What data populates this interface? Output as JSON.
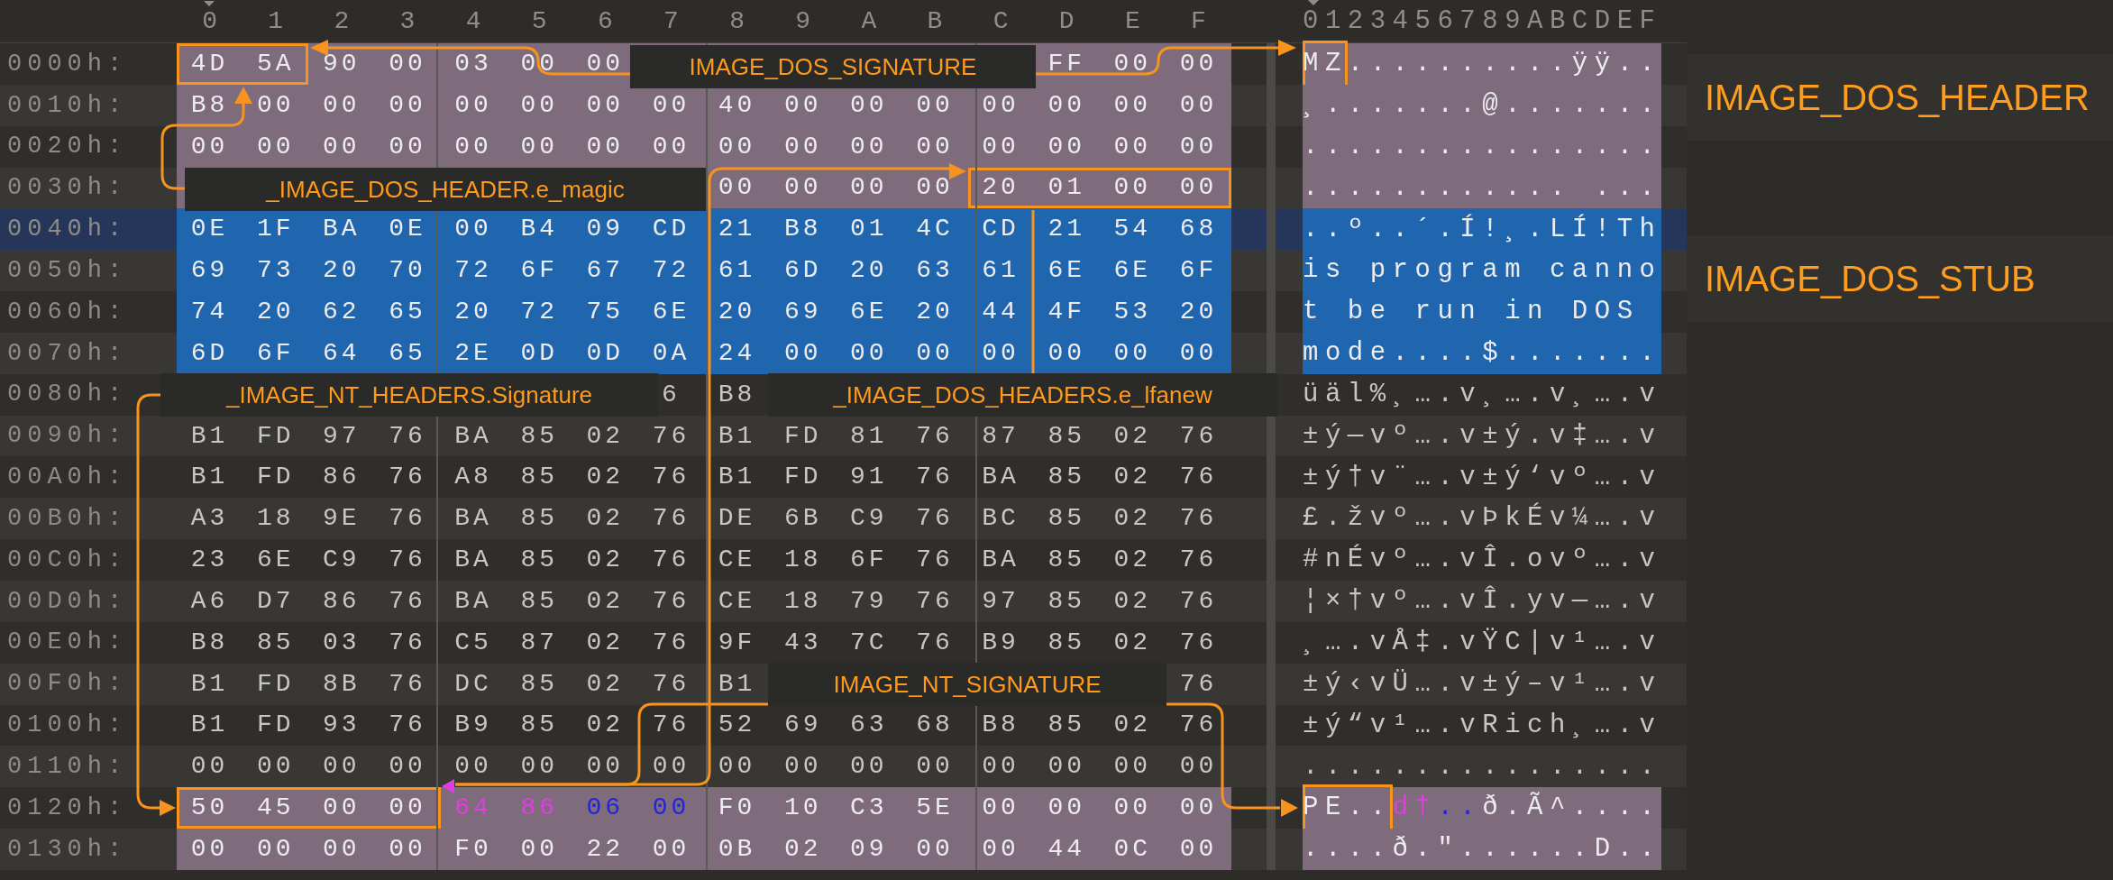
{
  "column_headers": [
    "0",
    "1",
    "2",
    "3",
    "4",
    "5",
    "6",
    "7",
    "8",
    "9",
    "A",
    "B",
    "C",
    "D",
    "E",
    "F"
  ],
  "ascii_header": "0123456789ABCDEF",
  "rows": [
    {
      "offset": "0000h:",
      "color": "#7e6b7c",
      "cursor": false,
      "hex": [
        {
          "kind": "boxed",
          "bytes": [
            "4D",
            "5A"
          ]
        },
        {
          "kind": "plain",
          "bytes": [
            "90",
            "00",
            "03",
            "00",
            "00"
          ]
        },
        {
          "kind": "covered"
        },
        {
          "kind": "plain",
          "bytes": [
            "FF",
            "00",
            "00"
          ]
        }
      ],
      "ascii": [
        {
          "kind": "boxed",
          "text": "MZ"
        },
        {
          "kind": "plain",
          "text": "..........ÿÿ.."
        }
      ]
    },
    {
      "offset": "0010h:",
      "color": "#7e6b7c",
      "cursor": false,
      "hex": [
        {
          "kind": "plain",
          "bytes": [
            "B8",
            "00",
            "00",
            "00",
            "00",
            "00",
            "00",
            "00",
            "40",
            "00",
            "00",
            "00",
            "00",
            "00",
            "00",
            "00"
          ]
        }
      ],
      "ascii": [
        {
          "kind": "plain",
          "text": "¸.......@......."
        }
      ]
    },
    {
      "offset": "0020h:",
      "color": "#7e6b7c",
      "cursor": false,
      "hex": [
        {
          "kind": "plain",
          "bytes": [
            "00",
            "00",
            "00",
            "00",
            "00",
            "00",
            "00",
            "00",
            "00",
            "00",
            "00",
            "00",
            "00",
            "00",
            "00",
            "00"
          ]
        }
      ],
      "ascii": [
        {
          "kind": "plain",
          "text": "................"
        }
      ]
    },
    {
      "offset": "0030h:",
      "color": "#7e6b7c",
      "cursor": false,
      "hex": [
        {
          "kind": "covered"
        },
        {
          "kind": "plain",
          "bytes": [
            "00",
            "00",
            "00",
            "00"
          ]
        },
        {
          "kind": "boxed",
          "bytes": [
            "20",
            "01",
            "00",
            "00"
          ]
        }
      ],
      "ascii": [
        {
          "kind": "plain",
          "text": "............ ..."
        }
      ]
    },
    {
      "offset": "0040h:",
      "color": "#2066ae",
      "cursor": true,
      "hex": [
        {
          "kind": "plain",
          "bytes": [
            "0E",
            "1F",
            "BA",
            "0E",
            "00",
            "B4",
            "09",
            "CD",
            "21",
            "B8",
            "01",
            "4C",
            "CD",
            "21",
            "54",
            "68"
          ]
        }
      ],
      "ascii": [
        {
          "kind": "plain",
          "text": "..º..´.Í!¸.LÍ!Th"
        }
      ]
    },
    {
      "offset": "0050h:",
      "color": "#2066ae",
      "cursor": false,
      "hex": [
        {
          "kind": "plain",
          "bytes": [
            "69",
            "73",
            "20",
            "70",
            "72",
            "6F",
            "67",
            "72",
            "61",
            "6D",
            "20",
            "63",
            "61",
            "6E",
            "6E",
            "6F"
          ]
        }
      ],
      "ascii": [
        {
          "kind": "plain",
          "text": "is program canno"
        }
      ]
    },
    {
      "offset": "0060h:",
      "color": "#2066ae",
      "cursor": false,
      "hex": [
        {
          "kind": "plain",
          "bytes": [
            "74",
            "20",
            "62",
            "65",
            "20",
            "72",
            "75",
            "6E",
            "20",
            "69",
            "6E",
            "20",
            "44",
            "4F",
            "53",
            "20"
          ]
        }
      ],
      "ascii": [
        {
          "kind": "plain",
          "text": "t be run in DOS "
        }
      ]
    },
    {
      "offset": "0070h:",
      "color": "#2066ae",
      "cursor": false,
      "hex": [
        {
          "kind": "plain",
          "bytes": [
            "6D",
            "6F",
            "64",
            "65",
            "2E",
            "0D",
            "0D",
            "0A",
            "24",
            "00",
            "00",
            "00",
            "00",
            "00",
            "00",
            "00"
          ]
        }
      ],
      "ascii": [
        {
          "kind": "plain",
          "text": "mode....$......."
        }
      ]
    },
    {
      "offset": "0080h:",
      "cursor": false,
      "hex": [
        {
          "kind": "covered"
        },
        {
          "kind": "plain",
          "bytes": [
            "6",
            "B8"
          ]
        },
        {
          "kind": "covered"
        }
      ],
      "ascii": [
        {
          "kind": "plain",
          "text": "üäl%¸….v¸….v¸….v"
        }
      ]
    },
    {
      "offset": "0090h:",
      "cursor": false,
      "hex": [
        {
          "kind": "plain",
          "bytes": [
            "B1",
            "FD",
            "97",
            "76",
            "BA",
            "85",
            "02",
            "76",
            "B1",
            "FD",
            "81",
            "76",
            "87",
            "85",
            "02",
            "76"
          ]
        }
      ],
      "ascii": [
        {
          "kind": "plain",
          "text": "±ý—vº….v±ý.v‡….v"
        }
      ]
    },
    {
      "offset": "00A0h:",
      "cursor": false,
      "hex": [
        {
          "kind": "plain",
          "bytes": [
            "B1",
            "FD",
            "86",
            "76",
            "A8",
            "85",
            "02",
            "76",
            "B1",
            "FD",
            "91",
            "76",
            "BA",
            "85",
            "02",
            "76"
          ]
        }
      ],
      "ascii": [
        {
          "kind": "plain",
          "text": "±ý†v¨….v±ý‘vº….v"
        }
      ]
    },
    {
      "offset": "00B0h:",
      "cursor": false,
      "hex": [
        {
          "kind": "plain",
          "bytes": [
            "A3",
            "18",
            "9E",
            "76",
            "BA",
            "85",
            "02",
            "76",
            "DE",
            "6B",
            "C9",
            "76",
            "BC",
            "85",
            "02",
            "76"
          ]
        }
      ],
      "ascii": [
        {
          "kind": "plain",
          "text": "£.žvº….vÞkÉv¼….v"
        }
      ]
    },
    {
      "offset": "00C0h:",
      "cursor": false,
      "hex": [
        {
          "kind": "plain",
          "bytes": [
            "23",
            "6E",
            "C9",
            "76",
            "BA",
            "85",
            "02",
            "76",
            "CE",
            "18",
            "6F",
            "76",
            "BA",
            "85",
            "02",
            "76"
          ]
        }
      ],
      "ascii": [
        {
          "kind": "plain",
          "text": "#nÉvº….vÎ.ovº….v"
        }
      ]
    },
    {
      "offset": "00D0h:",
      "cursor": false,
      "hex": [
        {
          "kind": "plain",
          "bytes": [
            "A6",
            "D7",
            "86",
            "76",
            "BA",
            "85",
            "02",
            "76",
            "CE",
            "18",
            "79",
            "76",
            "97",
            "85",
            "02",
            "76"
          ]
        }
      ],
      "ascii": [
        {
          "kind": "plain",
          "text": "¦×†vº….vÎ.yv—….v"
        }
      ]
    },
    {
      "offset": "00E0h:",
      "cursor": false,
      "hex": [
        {
          "kind": "plain",
          "bytes": [
            "B8",
            "85",
            "03",
            "76",
            "C5",
            "87",
            "02",
            "76",
            "9F",
            "43",
            "7C",
            "76",
            "B9",
            "85",
            "02",
            "76"
          ]
        }
      ],
      "ascii": [
        {
          "kind": "plain",
          "text": "¸….vÅ‡.vŸC|v¹….v"
        }
      ]
    },
    {
      "offset": "00F0h:",
      "cursor": false,
      "hex": [
        {
          "kind": "plain",
          "bytes": [
            "B1",
            "FD",
            "8B",
            "76",
            "DC",
            "85",
            "02",
            "76",
            "B1"
          ]
        },
        {
          "kind": "covered"
        },
        {
          "kind": "plain",
          "bytes": [
            "76"
          ]
        }
      ],
      "ascii": [
        {
          "kind": "plain",
          "text": "±ý‹vÜ….v±ý–v¹….v"
        }
      ]
    },
    {
      "offset": "0100h:",
      "cursor": false,
      "hex": [
        {
          "kind": "plain",
          "bytes": [
            "B1",
            "FD",
            "93",
            "76",
            "B9",
            "85",
            "02",
            "76",
            "52",
            "69",
            "63",
            "68",
            "B8",
            "85",
            "02",
            "76"
          ]
        }
      ],
      "ascii": [
        {
          "kind": "plain",
          "text": "±ý“v¹….vRich¸….v"
        }
      ]
    },
    {
      "offset": "0110h:",
      "cursor": false,
      "hex": [
        {
          "kind": "plain",
          "bytes": [
            "00",
            "00",
            "00",
            "00",
            "00",
            "00",
            "00",
            "00",
            "00",
            "00",
            "00",
            "00",
            "00",
            "00",
            "00",
            "00"
          ]
        }
      ],
      "ascii": [
        {
          "kind": "plain",
          "text": "................"
        }
      ]
    },
    {
      "offset": "0120h:",
      "color": "#7e6b7c",
      "cursor": false,
      "hex": [
        {
          "kind": "boxed",
          "bytes": [
            "50",
            "45",
            "00",
            "00"
          ]
        },
        {
          "kind": "magenta",
          "bytes": [
            "64",
            "86"
          ]
        },
        {
          "kind": "blue",
          "bytes": [
            "06",
            "00"
          ]
        },
        {
          "kind": "plain",
          "bytes": [
            "F0",
            "10",
            "C3",
            "5E",
            "00",
            "00",
            "00",
            "00"
          ]
        }
      ],
      "ascii": [
        {
          "kind": "boxed",
          "text": "PE.."
        },
        {
          "kind": "magenta",
          "text": "d†"
        },
        {
          "kind": "blue",
          "text": ".."
        },
        {
          "kind": "plain",
          "text": "ð.Ã^...."
        }
      ]
    },
    {
      "offset": "0130h:",
      "color": "#7e6b7c",
      "cursor": false,
      "hex": [
        {
          "kind": "plain",
          "bytes": [
            "00",
            "00",
            "00",
            "00",
            "F0",
            "00",
            "22",
            "00",
            "0B",
            "02",
            "09",
            "00",
            "00",
            "44",
            "0C",
            "00"
          ]
        }
      ],
      "ascii": [
        {
          "kind": "plain",
          "text": "....ð.\"......D.."
        }
      ]
    }
  ],
  "annotations": [
    {
      "text": "IMAGE_DOS_SIGNATURE"
    },
    {
      "text": "_IMAGE_DOS_HEADER.e_magic"
    },
    {
      "text": "_IMAGE_NT_HEADERS.Signature"
    },
    {
      "text": "_IMAGE_DOS_HEADERS.e_lfanew"
    },
    {
      "text": "IMAGE_NT_SIGNATURE"
    }
  ],
  "section_labels": [
    {
      "text": "IMAGE_DOS_HEADER"
    },
    {
      "text": "IMAGE_DOS_STUB"
    }
  ]
}
